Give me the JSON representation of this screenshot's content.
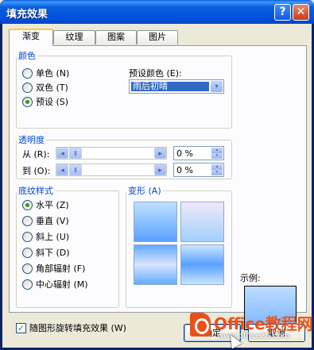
{
  "window": {
    "title": "填充效果",
    "help_label": "?",
    "close_label": "✕"
  },
  "tabs": [
    "渐变",
    "纹理",
    "图案",
    "图片"
  ],
  "colors_group": {
    "legend": "颜色",
    "options": [
      "单色 (N)",
      "双色 (T)",
      "预设 (S)"
    ],
    "selected_index": 2,
    "preset_label": "预设颜色 (E):",
    "preset_value": "雨后初晴"
  },
  "transparency_group": {
    "legend": "透明度",
    "from_label": "从 (R):",
    "to_label": "到 (O):",
    "from_value": "0 %",
    "to_value": "0 %"
  },
  "shading_group": {
    "legend": "底纹样式",
    "options": [
      "水平 (Z)",
      "垂直 (V)",
      "斜上 (U)",
      "斜下 (D)",
      "角部辐射 (F)",
      "中心辐射 (M)"
    ],
    "selected_index": 0
  },
  "variants": {
    "label": "变形 (A)"
  },
  "sample": {
    "label": "示例:"
  },
  "rotate_checkbox": {
    "label": "随图形旋转填充效果 (W)",
    "checked": true
  },
  "buttons": {
    "ok": "确定",
    "cancel": "取消"
  },
  "watermark": {
    "brand": "Office教程网",
    "url": "www.office26.com"
  },
  "icons": {
    "left": "◂",
    "right": "▸",
    "down": "▾",
    "up": "▴",
    "thumb": "⦀"
  }
}
